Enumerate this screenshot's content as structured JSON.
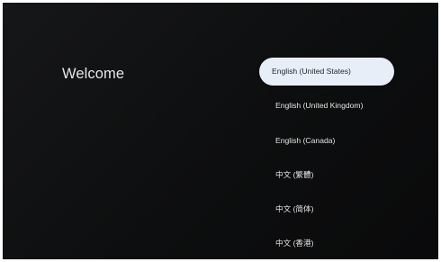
{
  "screen": {
    "title": "Welcome"
  },
  "languages": [
    {
      "label": "English (United States)",
      "selected": true
    },
    {
      "label": "English (United Kingdom)",
      "selected": false
    },
    {
      "label": "English (Canada)",
      "selected": false
    },
    {
      "label": "中文 (繁體)",
      "selected": false
    },
    {
      "label": "中文 (简体)",
      "selected": false
    },
    {
      "label": "中文 (香港)",
      "selected": false
    }
  ],
  "colors": {
    "background": "#0d0e0f",
    "selected_background": "#e8eef8",
    "text": "#e4e4e4",
    "selected_text": "#1f2329"
  }
}
